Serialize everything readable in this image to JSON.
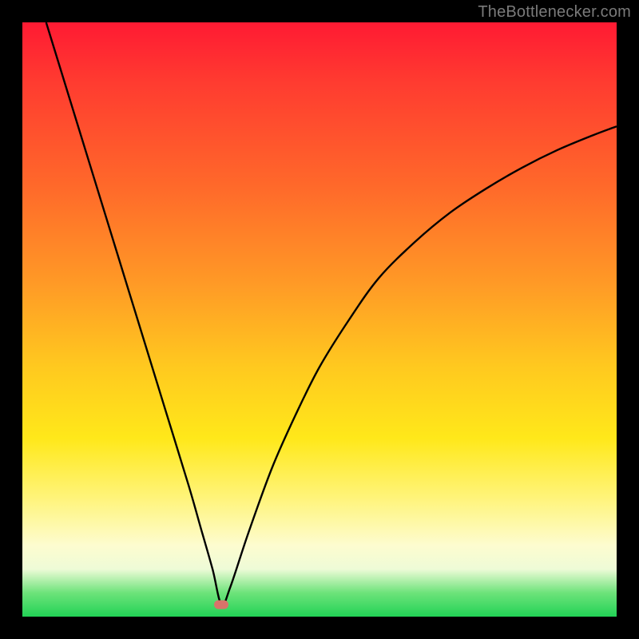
{
  "attribution": "TheBottlenecker.com",
  "colors": {
    "frame": "#000000",
    "gradient_top": "#ff1a33",
    "gradient_bottom": "#22d256",
    "curve": "#000000",
    "marker": "#d9736a",
    "attribution_text": "#7a7a7a"
  },
  "chart_data": {
    "type": "line",
    "title": "",
    "xlabel": "",
    "ylabel": "",
    "xlim": [
      0,
      100
    ],
    "ylim": [
      0,
      100
    ],
    "grid": false,
    "legend": false,
    "series": [
      {
        "name": "bottleneck-curve",
        "x": [
          4,
          8,
          12,
          16,
          20,
          24,
          28,
          30,
          32,
          33.5,
          35,
          38,
          42,
          46,
          50,
          55,
          60,
          66,
          72,
          78,
          84,
          90,
          96,
          100
        ],
        "values": [
          100,
          87,
          74,
          61,
          48,
          35,
          22,
          15,
          8,
          2,
          5,
          14,
          25,
          34,
          42,
          50,
          57,
          63,
          68,
          72,
          75.5,
          78.5,
          81,
          82.5
        ]
      }
    ],
    "annotations": [
      {
        "name": "min-marker",
        "x": 33.5,
        "y": 2
      }
    ]
  }
}
